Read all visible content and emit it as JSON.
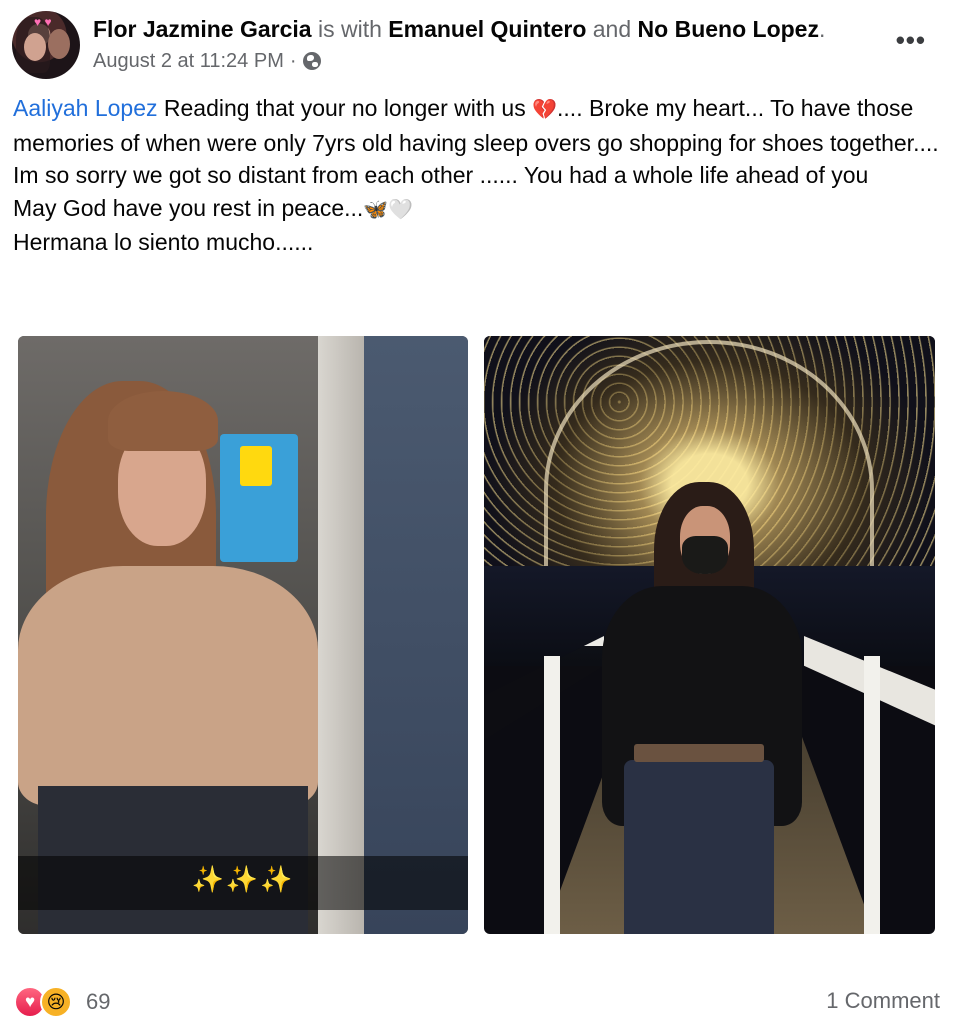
{
  "post": {
    "author": "Flor Jazmine Garcia",
    "with_text": " is with ",
    "tag1": "Emanuel Quintero",
    "and_text": " and ",
    "tag2": "No Bueno Lopez",
    "period": ".",
    "timestamp": "August 2 at 11:24 PM",
    "separator": "·",
    "privacy_icon": "globe-icon",
    "more_icon": "more-options-icon",
    "more_glyph": "•••"
  },
  "body": {
    "mention": "Aaliyah Lopez",
    "line1_rest": " Reading that your no longer with us ",
    "line1_emoji": "💔",
    "line1_after": "....   Broke my heart... To have those memories of when were only 7yrs old having sleep overs go shopping for shoes together....",
    "line2": "Im so sorry we got so distant from each other ...... You had a whole life ahead of you",
    "line3_text": "May God have you rest in peace...",
    "line3_emoji": "🦋🤍",
    "line4": "Hermana lo siento mucho......"
  },
  "photos": {
    "photo1_caption": "✨✨✨"
  },
  "footer": {
    "love_icon": "♥",
    "sad_icon": "😢",
    "reaction_count": "69",
    "comments": "1 Comment"
  },
  "colors": {
    "mention": "#216fdb",
    "secondary_text": "#65676b",
    "love": "#f33e58",
    "sad": "#f7b125"
  }
}
